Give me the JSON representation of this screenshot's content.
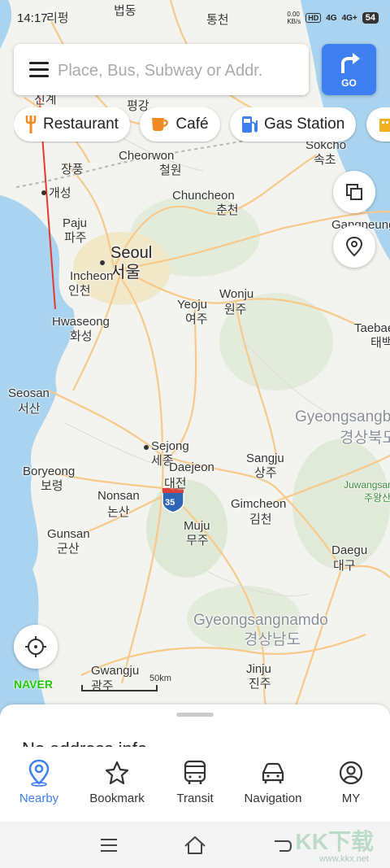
{
  "status": {
    "time": "14:17",
    "net_speed": "0.00",
    "net_unit": "KB/s",
    "hd": "HD",
    "signal1": "4G",
    "signal2": "4G+",
    "battery": "54"
  },
  "search": {
    "placeholder": "Place, Bus, Subway or Addr.",
    "go_label": "GO"
  },
  "chips": [
    "Restaurant",
    "Café",
    "Gas Station"
  ],
  "map": {
    "labels": [
      {
        "t": "리펑",
        "c": ""
      },
      {
        "t": "법동",
        "c": ""
      },
      {
        "t": "통천",
        "c": ""
      },
      {
        "t": "평강",
        "c": ""
      },
      {
        "t": "신계",
        "c": ""
      },
      {
        "t": "Sokcho",
        "c": ""
      },
      {
        "t": "속초",
        "c": ""
      },
      {
        "t": "Cheorwon",
        "c": ""
      },
      {
        "t": "철원",
        "c": ""
      },
      {
        "t": "장풍",
        "c": ""
      },
      {
        "t": "개성",
        "c": ""
      },
      {
        "t": "Chuncheon",
        "c": ""
      },
      {
        "t": "춘천",
        "c": ""
      },
      {
        "t": "Paju",
        "c": ""
      },
      {
        "t": "파주",
        "c": ""
      },
      {
        "t": "Gangneung",
        "c": ""
      },
      {
        "t": "Seoul",
        "c": "big"
      },
      {
        "t": "서울",
        "c": "big"
      },
      {
        "t": "Incheon",
        "c": ""
      },
      {
        "t": "인천",
        "c": ""
      },
      {
        "t": "Wonju",
        "c": ""
      },
      {
        "t": "원주",
        "c": ""
      },
      {
        "t": "Yeoju",
        "c": ""
      },
      {
        "t": "여주",
        "c": ""
      },
      {
        "t": "Hwaseong",
        "c": ""
      },
      {
        "t": "화성",
        "c": ""
      },
      {
        "t": "Taebaek",
        "c": ""
      },
      {
        "t": "태백",
        "c": ""
      },
      {
        "t": "Seosan",
        "c": ""
      },
      {
        "t": "서산",
        "c": ""
      },
      {
        "t": "Gyeongsangbukdo",
        "c": "region"
      },
      {
        "t": "경상북도",
        "c": "region"
      },
      {
        "t": "Sejong",
        "c": ""
      },
      {
        "t": "세종",
        "c": ""
      },
      {
        "t": "Daejeon",
        "c": ""
      },
      {
        "t": "대전",
        "c": ""
      },
      {
        "t": "Sangju",
        "c": ""
      },
      {
        "t": "상주",
        "c": ""
      },
      {
        "t": "Boryeong",
        "c": ""
      },
      {
        "t": "보령",
        "c": ""
      },
      {
        "t": "Juwangsan",
        "c": "green"
      },
      {
        "t": "주왕산",
        "c": "green"
      },
      {
        "t": "Nonsan",
        "c": ""
      },
      {
        "t": "논산",
        "c": ""
      },
      {
        "t": "Gimcheon",
        "c": ""
      },
      {
        "t": "김천",
        "c": ""
      },
      {
        "t": "Muju",
        "c": ""
      },
      {
        "t": "무주",
        "c": ""
      },
      {
        "t": "Gunsan",
        "c": ""
      },
      {
        "t": "군산",
        "c": ""
      },
      {
        "t": "Daegu",
        "c": ""
      },
      {
        "t": "대구",
        "c": ""
      },
      {
        "t": "Gyeongsangnamdo",
        "c": "region"
      },
      {
        "t": "경상남도",
        "c": "region"
      },
      {
        "t": "Gwangju",
        "c": ""
      },
      {
        "t": "광주",
        "c": ""
      },
      {
        "t": "Jinju",
        "c": ""
      },
      {
        "t": "진주",
        "c": ""
      },
      {
        "t": "35",
        "c": "sm"
      }
    ],
    "logo": "NAVER",
    "scale": "50km"
  },
  "sheet": {
    "text": "No address info"
  },
  "tabs": [
    {
      "label": "Nearby",
      "icon": "location-pin-icon"
    },
    {
      "label": "Bookmark",
      "icon": "star-icon"
    },
    {
      "label": "Transit",
      "icon": "bus-icon"
    },
    {
      "label": "Navigation",
      "icon": "car-icon"
    },
    {
      "label": "MY",
      "icon": "user-icon"
    }
  ],
  "watermark": {
    "brand": "KK下载",
    "url": "www.kkx.net"
  },
  "colors": {
    "accent": "#3d7ef0",
    "sea": "#a9d3ee",
    "land": "#f3f3ef",
    "road": "#f6c98a",
    "naver": "#1ec800"
  }
}
